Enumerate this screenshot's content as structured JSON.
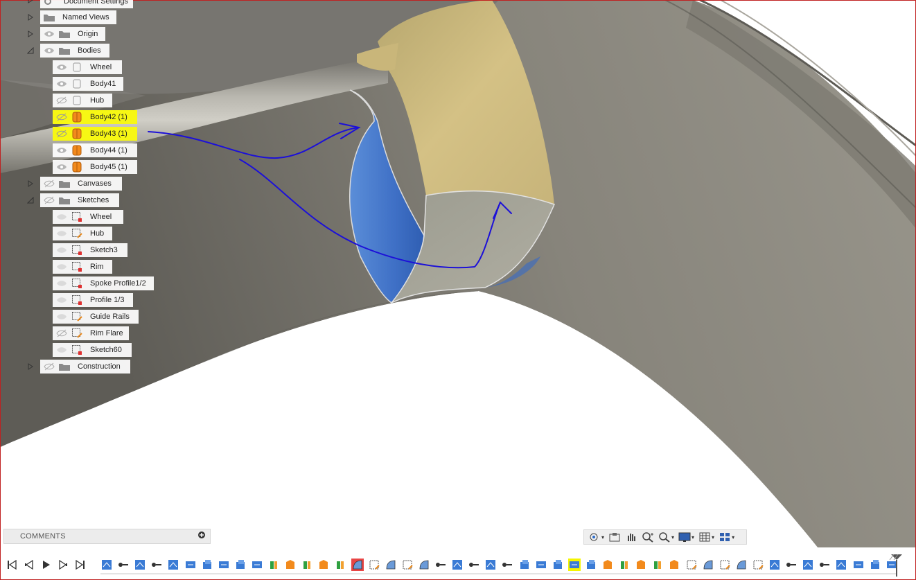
{
  "browser": {
    "top_partial": {
      "label": "Document Settings"
    },
    "folders": [
      {
        "label": "Named Views"
      },
      {
        "label": "Origin"
      },
      {
        "label": "Bodies"
      },
      {
        "label": "Canvases"
      },
      {
        "label": "Sketches"
      },
      {
        "label": "Construction"
      }
    ],
    "bodies": [
      {
        "label": "Wheel",
        "visible": true,
        "highlighted": false
      },
      {
        "label": "Body41",
        "visible": true,
        "highlighted": false
      },
      {
        "label": "Hub",
        "visible": false,
        "highlighted": false
      },
      {
        "label": "Body42 (1)",
        "visible": false,
        "highlighted": true
      },
      {
        "label": "Body43 (1)",
        "visible": false,
        "highlighted": true
      },
      {
        "label": "Body44 (1)",
        "visible": true,
        "highlighted": false
      },
      {
        "label": "Body45 (1)",
        "visible": true,
        "highlighted": false
      }
    ],
    "sketches": [
      {
        "label": "Wheel"
      },
      {
        "label": "Hub"
      },
      {
        "label": "Sketch3"
      },
      {
        "label": "Rim"
      },
      {
        "label": "Spoke Profile1/2"
      },
      {
        "label": "Profile 1/3"
      },
      {
        "label": "Guide Rails"
      },
      {
        "label": "Rim Flare"
      },
      {
        "label": "Sketch60"
      }
    ]
  },
  "comments": {
    "label": "COMMENTS"
  },
  "navbar": {
    "icons": [
      "orbit-icon",
      "look-at-icon",
      "pan-icon",
      "zoom-icon",
      "zoom-window-icon",
      "display-settings-icon",
      "grid-icon",
      "viewports-icon"
    ]
  },
  "timeline": {
    "playback": [
      "go-to-start-icon",
      "step-back-icon",
      "play-icon",
      "step-forward-icon",
      "go-to-end-icon"
    ],
    "feature_count": 48,
    "highlighted_yellow_index": 28,
    "highlighted_red_index": 15
  },
  "colors": {
    "highlight_yellow": "#f7f714",
    "body_orange": "#f28a1c",
    "annotation_blue": "#1c10d8",
    "surface_blue": "#4a7bd0",
    "surface_tan": "#d0bd80",
    "model_gray": "#8d8a80"
  }
}
